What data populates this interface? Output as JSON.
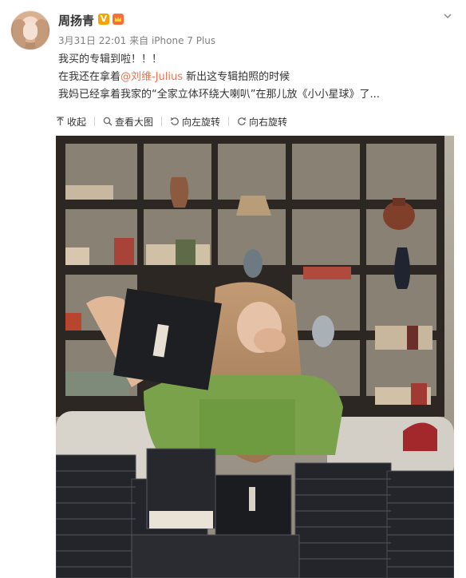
{
  "user": {
    "name": "周扬青",
    "verified_badge": "V"
  },
  "meta": {
    "date": "3月31日 22:01",
    "from": "来自 iPhone 7 Plus"
  },
  "post": {
    "line1": "我买的专辑到啦！！！",
    "line2_pre": "在我还在拿着",
    "mention": "@刘维-Julius",
    "line2_post": " 新出这专辑拍照的时候",
    "line3": "我妈已经拿着我家的“全家立体环绕大喇叭”在那儿放《小小星球》了..."
  },
  "toolbar": {
    "collapse": "收起",
    "view_large": "查看大图",
    "rotate_left": "向左旋转",
    "rotate_right": "向右旋转"
  },
  "icons": {
    "collapse": "arrow-up-icon",
    "view_large": "search-icon",
    "rotate_left": "rotate-left-icon",
    "rotate_right": "rotate-right-icon",
    "menu": "chevron-down-icon",
    "crown": "crown-icon"
  },
  "colors": {
    "link": "#eb7350",
    "verified": "#f7a400",
    "text": "#333333",
    "meta": "#808080"
  }
}
